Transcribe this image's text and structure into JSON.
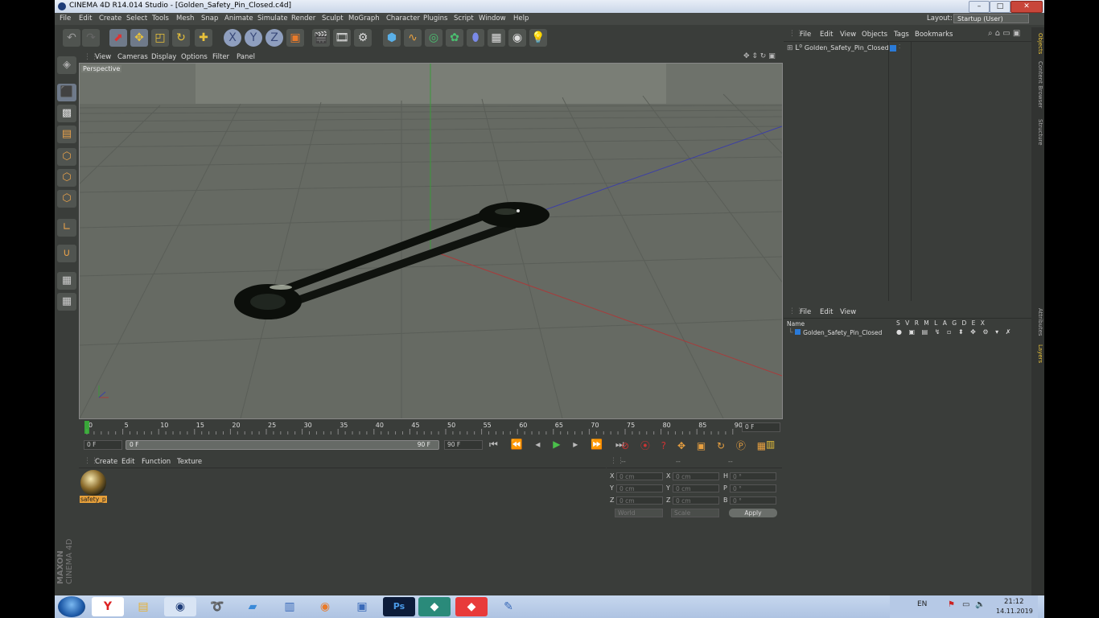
{
  "window": {
    "title": "CINEMA 4D R14.014 Studio - [Golden_Safety_Pin_Closed.c4d]"
  },
  "menu": [
    "File",
    "Edit",
    "Create",
    "Select",
    "Tools",
    "Mesh",
    "Snap",
    "Animate",
    "Simulate",
    "Render",
    "Sculpt",
    "MoGraph",
    "Character",
    "Plugins",
    "Script",
    "Window",
    "Help"
  ],
  "layout": {
    "label": "Layout:",
    "value": "Startup (User)"
  },
  "viewport": {
    "menu": [
      "View",
      "Cameras",
      "Display",
      "Options",
      "Filter",
      "Panel"
    ],
    "label": "Perspective"
  },
  "timeline": {
    "ticks": [
      "0",
      "5",
      "10",
      "15",
      "20",
      "25",
      "30",
      "35",
      "40",
      "45",
      "50",
      "55",
      "60",
      "65",
      "70",
      "75",
      "80",
      "85",
      "90"
    ],
    "current": "0 F"
  },
  "transport": {
    "start": "0 F",
    "range_start": "0 F",
    "range_end": "90 F",
    "end": "90 F"
  },
  "material_panel": {
    "menu": [
      "Create",
      "Edit",
      "Function",
      "Texture"
    ],
    "material_label": "safety_p"
  },
  "coords": {
    "headers": [
      "--",
      "--",
      "--"
    ],
    "rows": [
      {
        "a": "X",
        "av": "0 cm",
        "b": "X",
        "bv": "0 cm",
        "c": "H",
        "cv": "0 °"
      },
      {
        "a": "Y",
        "av": "0 cm",
        "b": "Y",
        "bv": "0 cm",
        "c": "P",
        "cv": "0 °"
      },
      {
        "a": "Z",
        "av": "0 cm",
        "b": "Z",
        "bv": "0 cm",
        "c": "B",
        "cv": "0 °"
      }
    ],
    "mode": "World",
    "scale": "Scale",
    "apply": "Apply"
  },
  "objects_panel": {
    "menu": [
      "File",
      "Edit",
      "View",
      "Objects",
      "Tags",
      "Bookmarks"
    ],
    "object": "Golden_Safety_Pin_Closed"
  },
  "layers_panel": {
    "menu": [
      "File",
      "Edit",
      "View"
    ],
    "name_col": "Name",
    "cols": [
      "S",
      "V",
      "R",
      "M",
      "L",
      "A",
      "G",
      "D",
      "E",
      "X"
    ],
    "object": "Golden_Safety_Pin_Closed"
  },
  "side_tabs": [
    "Objects",
    "Content Browser",
    "Structure"
  ],
  "side_tabs2": [
    "Attributes",
    "Layers"
  ],
  "brand": {
    "maxon": "MAXON",
    "product": "CINEMA 4D"
  },
  "taskbar": {
    "lang": "EN",
    "time": "21:12",
    "date": "14.11.2019"
  },
  "colors": {
    "accent": "#e9c23a",
    "ui_bg": "#3a3d3a",
    "viewport_bg": "#6c706a"
  }
}
